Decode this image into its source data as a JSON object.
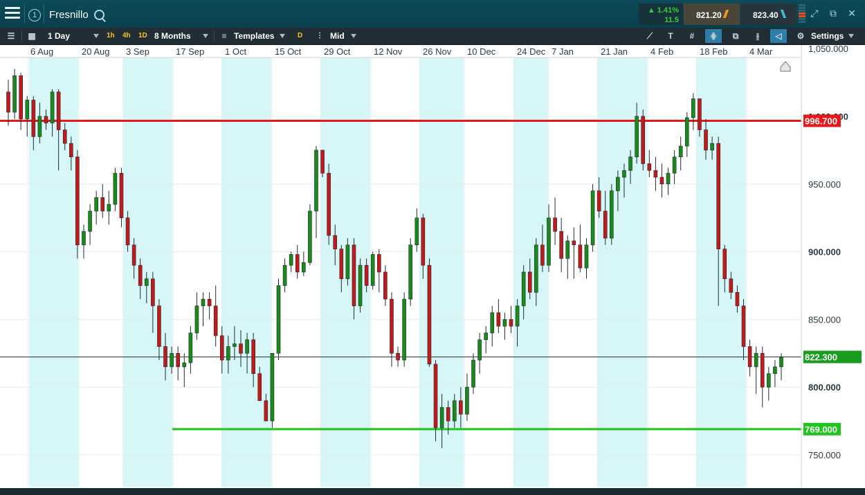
{
  "header": {
    "menu_icon": "hamburger-menu-icon",
    "layout_badge": "1",
    "instrument": "Fresnillo",
    "change_pct": "1.41%",
    "change_abs": "11.5",
    "sell_price": "821.20",
    "buy_price": "823.40"
  },
  "toolbar": {
    "interval": "1 Day",
    "quick_1h": "1h",
    "quick_4h": "4h",
    "quick_1d": "1D",
    "range": "8 Months",
    "templates": "Templates",
    "d_badge": "D",
    "price_type": "Mid",
    "settings": "Settings"
  },
  "chart_data": {
    "type": "candlestick",
    "instrument": "Fresnillo",
    "date_labels": [
      "6 Aug",
      "20 Aug",
      "3 Sep",
      "17 Sep",
      "1 Oct",
      "15 Oct",
      "29 Oct",
      "12 Nov",
      "26 Nov",
      "10 Dec",
      "24 Dec",
      "7 Jan",
      "21 Jan",
      "4 Feb",
      "18 Feb",
      "4 Mar"
    ],
    "y_ticks": [
      "1,050.000",
      "1,000.000",
      "950.000",
      "900.000",
      "850.000",
      "800.000",
      "750.000"
    ],
    "y_tick_values": [
      1050,
      1000,
      950,
      900,
      850,
      800,
      750
    ],
    "ylim": [
      733,
      1060
    ],
    "current_price": "822.300",
    "current_price_value": 822.3,
    "resistance": {
      "label": "996.700",
      "value": 996.7,
      "color": "#e8171a"
    },
    "support": {
      "label": "769.000",
      "value": 769.0,
      "color": "#1ec51a"
    },
    "up_color": "#1a8a1a",
    "down_color": "#c21a1a",
    "candles": [
      [
        1018,
        1027,
        993,
        1003
      ],
      [
        1003,
        1035,
        998,
        1030
      ],
      [
        1030,
        1032,
        990,
        998
      ],
      [
        998,
        1015,
        985,
        1012
      ],
      [
        1012,
        1015,
        975,
        985
      ],
      [
        985,
        1010,
        980,
        1000
      ],
      [
        1000,
        1005,
        990,
        995
      ],
      [
        995,
        1020,
        985,
        1018
      ],
      [
        1018,
        1020,
        960,
        990
      ],
      [
        990,
        995,
        975,
        980
      ],
      [
        980,
        985,
        960,
        970
      ],
      [
        970,
        975,
        895,
        905
      ],
      [
        905,
        920,
        895,
        915
      ],
      [
        915,
        935,
        905,
        930
      ],
      [
        930,
        945,
        920,
        940
      ],
      [
        940,
        950,
        925,
        930
      ],
      [
        930,
        945,
        920,
        935
      ],
      [
        935,
        962,
        930,
        958
      ],
      [
        958,
        962,
        918,
        925
      ],
      [
        925,
        930,
        900,
        905
      ],
      [
        905,
        910,
        880,
        890
      ],
      [
        890,
        895,
        865,
        875
      ],
      [
        875,
        885,
        862,
        880
      ],
      [
        880,
        885,
        840,
        860
      ],
      [
        860,
        865,
        820,
        830
      ],
      [
        830,
        840,
        805,
        815
      ],
      [
        815,
        830,
        810,
        825
      ],
      [
        825,
        830,
        805,
        815
      ],
      [
        815,
        825,
        800,
        818
      ],
      [
        818,
        845,
        810,
        840
      ],
      [
        840,
        870,
        835,
        860
      ],
      [
        860,
        870,
        845,
        865
      ],
      [
        865,
        870,
        850,
        860
      ],
      [
        860,
        875,
        830,
        838
      ],
      [
        838,
        845,
        810,
        820
      ],
      [
        820,
        838,
        810,
        830
      ],
      [
        830,
        845,
        820,
        832
      ],
      [
        832,
        842,
        815,
        825
      ],
      [
        825,
        840,
        810,
        835
      ],
      [
        835,
        840,
        800,
        810
      ],
      [
        810,
        815,
        795,
        790
      ],
      [
        790,
        795,
        780,
        775
      ],
      [
        775,
        825,
        770,
        825
      ],
      [
        825,
        880,
        820,
        875
      ],
      [
        875,
        895,
        870,
        890
      ],
      [
        890,
        900,
        885,
        898
      ],
      [
        898,
        905,
        880,
        885
      ],
      [
        885,
        900,
        882,
        892
      ],
      [
        892,
        935,
        890,
        930
      ],
      [
        930,
        978,
        910,
        975
      ],
      [
        975,
        970,
        955,
        958
      ],
      [
        958,
        965,
        905,
        912
      ],
      [
        912,
        920,
        890,
        902
      ],
      [
        902,
        905,
        870,
        880
      ],
      [
        880,
        910,
        875,
        905
      ],
      [
        905,
        910,
        850,
        860
      ],
      [
        860,
        895,
        855,
        890
      ],
      [
        890,
        895,
        870,
        875
      ],
      [
        875,
        900,
        872,
        898
      ],
      [
        898,
        902,
        870,
        885
      ],
      [
        885,
        890,
        860,
        865
      ],
      [
        865,
        870,
        815,
        825
      ],
      [
        825,
        830,
        815,
        820
      ],
      [
        820,
        870,
        815,
        865
      ],
      [
        865,
        910,
        860,
        905
      ],
      [
        905,
        932,
        900,
        925
      ],
      [
        925,
        928,
        880,
        890
      ],
      [
        890,
        895,
        815,
        817
      ],
      [
        817,
        820,
        760,
        770
      ],
      [
        770,
        795,
        755,
        785
      ],
      [
        785,
        790,
        765,
        775
      ],
      [
        775,
        795,
        770,
        790
      ],
      [
        790,
        800,
        770,
        780
      ],
      [
        780,
        810,
        775,
        800
      ],
      [
        800,
        825,
        795,
        820
      ],
      [
        820,
        840,
        810,
        835
      ],
      [
        835,
        845,
        825,
        840
      ],
      [
        840,
        860,
        830,
        855
      ],
      [
        855,
        865,
        840,
        845
      ],
      [
        845,
        855,
        835,
        850
      ],
      [
        850,
        860,
        840,
        845
      ],
      [
        845,
        865,
        830,
        860
      ],
      [
        860,
        890,
        850,
        885
      ],
      [
        885,
        895,
        865,
        870
      ],
      [
        870,
        910,
        860,
        905
      ],
      [
        905,
        920,
        885,
        890
      ],
      [
        890,
        935,
        885,
        925
      ],
      [
        925,
        940,
        905,
        915
      ],
      [
        915,
        925,
        885,
        895
      ],
      [
        895,
        912,
        880,
        908
      ],
      [
        908,
        918,
        880,
        905
      ],
      [
        905,
        920,
        885,
        888
      ],
      [
        888,
        910,
        880,
        905
      ],
      [
        905,
        950,
        900,
        945
      ],
      [
        945,
        955,
        925,
        930
      ],
      [
        930,
        945,
        905,
        910
      ],
      [
        910,
        950,
        905,
        945
      ],
      [
        945,
        960,
        930,
        955
      ],
      [
        955,
        965,
        940,
        960
      ],
      [
        960,
        975,
        950,
        970
      ],
      [
        970,
        1010,
        965,
        1000
      ],
      [
        1000,
        1005,
        960,
        965
      ],
      [
        965,
        975,
        955,
        960
      ],
      [
        960,
        970,
        945,
        955
      ],
      [
        955,
        965,
        940,
        950
      ],
      [
        950,
        962,
        942,
        958
      ],
      [
        958,
        975,
        950,
        970
      ],
      [
        970,
        985,
        960,
        978
      ],
      [
        978,
        1003,
        970,
        999
      ],
      [
        999,
        1017,
        990,
        1013
      ],
      [
        1013,
        1005,
        985,
        990
      ],
      [
        990,
        998,
        968,
        975
      ],
      [
        975,
        985,
        968,
        980
      ],
      [
        980,
        985,
        860,
        902
      ],
      [
        902,
        905,
        870,
        880
      ],
      [
        880,
        885,
        865,
        870
      ],
      [
        870,
        875,
        855,
        860
      ],
      [
        860,
        865,
        820,
        830
      ],
      [
        830,
        835,
        808,
        815
      ],
      [
        815,
        830,
        795,
        825
      ],
      [
        825,
        830,
        785,
        800
      ],
      [
        800,
        815,
        790,
        810
      ],
      [
        810,
        820,
        800,
        815
      ],
      [
        815,
        825,
        805,
        822
      ]
    ]
  }
}
